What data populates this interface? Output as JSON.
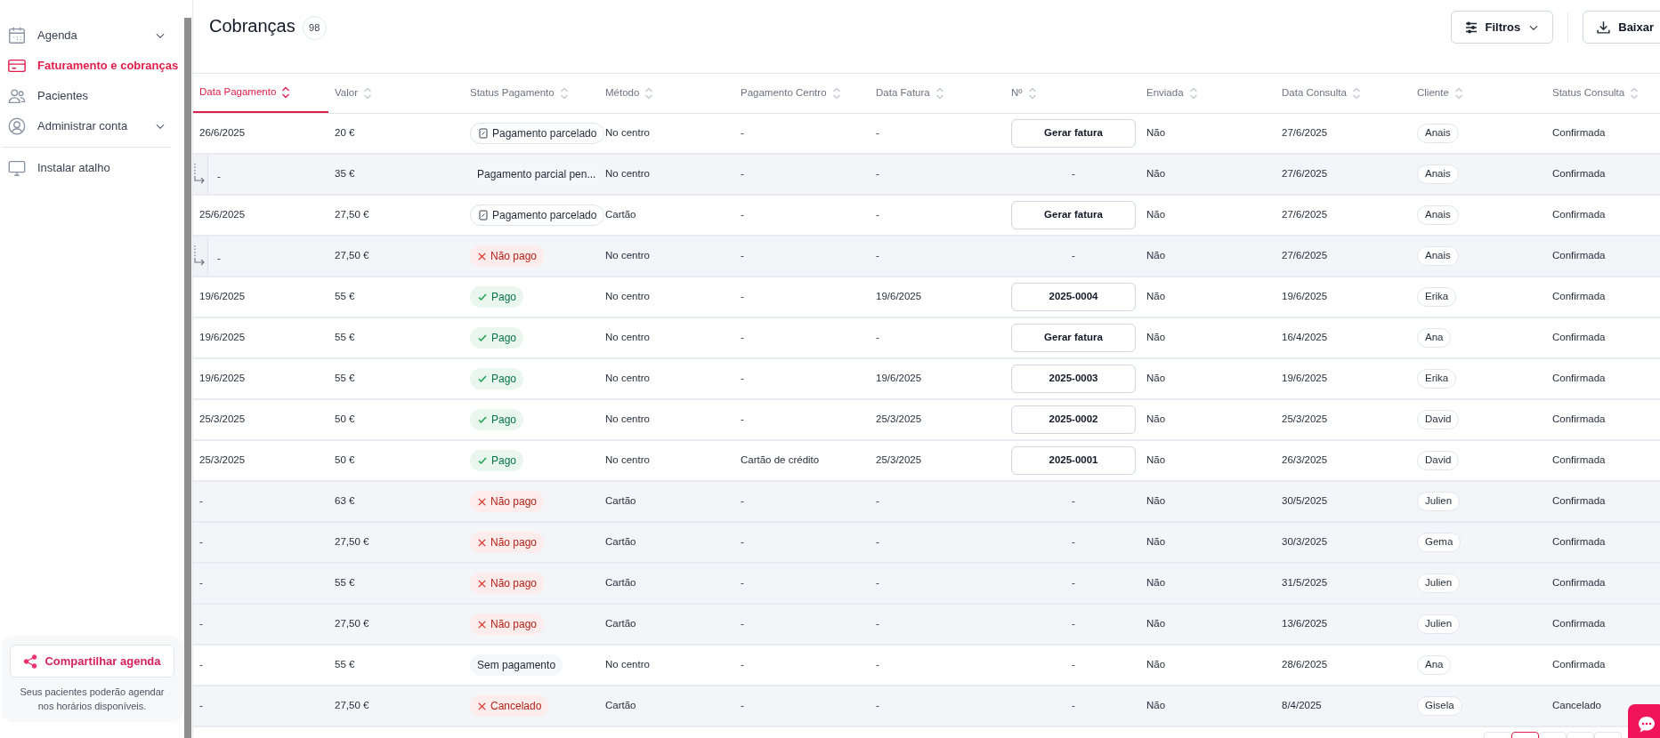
{
  "sidebar": {
    "items": [
      {
        "label": "Agenda",
        "selected": false,
        "expanded": false
      },
      {
        "label": "Faturamento e cobranças",
        "selected": true
      },
      {
        "label": "Pacientes",
        "selected": false
      },
      {
        "label": "Administrar conta",
        "selected": false,
        "expanded": false
      },
      {
        "label": "Instalar atalho",
        "selected": false
      }
    ],
    "share_card": {
      "button": "Compartilhar agenda",
      "text": "Seus pacientes poderão agendar nos horários disponíveis."
    }
  },
  "header": {
    "title": "Cobranças",
    "count": "98",
    "buttons": [
      "Filtros",
      "Baixar"
    ]
  },
  "table": {
    "columns": [
      {
        "label": "Data Pagamento",
        "selected": true
      },
      {
        "label": "Valor",
        "selected": false
      },
      {
        "label": "Status Pagamento",
        "selected": false
      },
      {
        "label": "Método",
        "selected": false
      },
      {
        "label": "Pagamento Centro",
        "selected": false
      },
      {
        "label": "Data Fatura",
        "selected": false
      },
      {
        "label": "Nº",
        "selected": false
      },
      {
        "label": "Enviada",
        "selected": false
      },
      {
        "label": "Data Consulta",
        "selected": false
      },
      {
        "label": "Cliente",
        "selected": false
      },
      {
        "label": "Status Consulta",
        "selected": false
      }
    ],
    "rows": [
      {
        "kind": "main",
        "highlighted": false,
        "date_paid": "26/6/2025",
        "amount": "20 €",
        "status": {
          "kind": "installment",
          "label": "Pagamento parcelado"
        },
        "method": "No centro",
        "center_payment": "-",
        "invoice_date": "-",
        "number": {
          "kind": "button",
          "text": "Gerar fatura"
        },
        "sent": "Não",
        "appointment_date": "27/6/2025",
        "client": "Anais",
        "appointment_status": "Confirmada"
      },
      {
        "kind": "sub",
        "highlighted": true,
        "date_paid": "-",
        "amount": "35 €",
        "status": {
          "kind": "partial",
          "label": "Pagamento parcial pen..."
        },
        "method": "No centro",
        "center_payment": "-",
        "invoice_date": "-",
        "number": {
          "kind": "text",
          "text": "-"
        },
        "sent": "Não",
        "appointment_date": "27/6/2025",
        "client": "Anais",
        "appointment_status": "Confirmada"
      },
      {
        "kind": "main",
        "highlighted": false,
        "date_paid": "25/6/2025",
        "amount": "27,50 €",
        "status": {
          "kind": "installment",
          "label": "Pagamento parcelado"
        },
        "method": "Cartão",
        "center_payment": "-",
        "invoice_date": "-",
        "number": {
          "kind": "button",
          "text": "Gerar fatura"
        },
        "sent": "Não",
        "appointment_date": "27/6/2025",
        "client": "Anais",
        "appointment_status": "Confirmada"
      },
      {
        "kind": "sub",
        "highlighted": true,
        "date_paid": "-",
        "amount": "27,50 €",
        "status": {
          "kind": "unpaid",
          "label": "Não pago"
        },
        "method": "No centro",
        "center_payment": "-",
        "invoice_date": "-",
        "number": {
          "kind": "text",
          "text": "-"
        },
        "sent": "Não",
        "appointment_date": "27/6/2025",
        "client": "Anais",
        "appointment_status": "Confirmada"
      },
      {
        "kind": "main",
        "highlighted": false,
        "date_paid": "19/6/2025",
        "amount": "55 €",
        "status": {
          "kind": "paid",
          "label": "Pago"
        },
        "method": "No centro",
        "center_payment": "-",
        "invoice_date": "19/6/2025",
        "number": {
          "kind": "button",
          "text": "2025-0004"
        },
        "sent": "Não",
        "appointment_date": "19/6/2025",
        "client": "Erika",
        "appointment_status": "Confirmada"
      },
      {
        "kind": "main",
        "highlighted": false,
        "date_paid": "19/6/2025",
        "amount": "55 €",
        "status": {
          "kind": "paid",
          "label": "Pago"
        },
        "method": "No centro",
        "center_payment": "-",
        "invoice_date": "-",
        "number": {
          "kind": "button",
          "text": "Gerar fatura"
        },
        "sent": "Não",
        "appointment_date": "16/4/2025",
        "client": "Ana",
        "appointment_status": "Confirmada"
      },
      {
        "kind": "main",
        "highlighted": false,
        "date_paid": "19/6/2025",
        "amount": "55 €",
        "status": {
          "kind": "paid",
          "label": "Pago"
        },
        "method": "No centro",
        "center_payment": "-",
        "invoice_date": "19/6/2025",
        "number": {
          "kind": "button",
          "text": "2025-0003"
        },
        "sent": "Não",
        "appointment_date": "19/6/2025",
        "client": "Erika",
        "appointment_status": "Confirmada"
      },
      {
        "kind": "main",
        "highlighted": false,
        "date_paid": "25/3/2025",
        "amount": "50 €",
        "status": {
          "kind": "paid",
          "label": "Pago"
        },
        "method": "No centro",
        "center_payment": "-",
        "invoice_date": "25/3/2025",
        "number": {
          "kind": "button",
          "text": "2025-0002"
        },
        "sent": "Não",
        "appointment_date": "25/3/2025",
        "client": "David",
        "appointment_status": "Confirmada"
      },
      {
        "kind": "main",
        "highlighted": false,
        "date_paid": "25/3/2025",
        "amount": "50 €",
        "status": {
          "kind": "paid",
          "label": "Pago"
        },
        "method": "No centro",
        "center_payment": "Cartão de crédito",
        "invoice_date": "25/3/2025",
        "number": {
          "kind": "button",
          "text": "2025-0001"
        },
        "sent": "Não",
        "appointment_date": "26/3/2025",
        "client": "David",
        "appointment_status": "Confirmada"
      },
      {
        "kind": "main",
        "highlighted": true,
        "date_paid": "-",
        "amount": "63 €",
        "status": {
          "kind": "unpaid",
          "label": "Não pago"
        },
        "method": "Cartão",
        "center_payment": "-",
        "invoice_date": "-",
        "number": {
          "kind": "text",
          "text": "-"
        },
        "sent": "Não",
        "appointment_date": "30/5/2025",
        "client": "Julien",
        "appointment_status": "Confirmada"
      },
      {
        "kind": "main",
        "highlighted": true,
        "date_paid": "-",
        "amount": "27,50 €",
        "status": {
          "kind": "unpaid",
          "label": "Não pago"
        },
        "method": "Cartão",
        "center_payment": "-",
        "invoice_date": "-",
        "number": {
          "kind": "text",
          "text": "-"
        },
        "sent": "Não",
        "appointment_date": "30/3/2025",
        "client": "Gema",
        "appointment_status": "Confirmada"
      },
      {
        "kind": "main",
        "highlighted": true,
        "date_paid": "-",
        "amount": "55 €",
        "status": {
          "kind": "unpaid",
          "label": "Não pago"
        },
        "method": "Cartão",
        "center_payment": "-",
        "invoice_date": "-",
        "number": {
          "kind": "text",
          "text": "-"
        },
        "sent": "Não",
        "appointment_date": "31/5/2025",
        "client": "Julien",
        "appointment_status": "Confirmada"
      },
      {
        "kind": "main",
        "highlighted": true,
        "date_paid": "-",
        "amount": "27,50 €",
        "status": {
          "kind": "unpaid",
          "label": "Não pago"
        },
        "method": "Cartão",
        "center_payment": "-",
        "invoice_date": "-",
        "number": {
          "kind": "text",
          "text": "-"
        },
        "sent": "Não",
        "appointment_date": "13/6/2025",
        "client": "Julien",
        "appointment_status": "Confirmada"
      },
      {
        "kind": "main",
        "highlighted": false,
        "date_paid": "-",
        "amount": "55 €",
        "status": {
          "kind": "none",
          "label": "Sem pagamento"
        },
        "method": "No centro",
        "center_payment": "-",
        "invoice_date": "-",
        "number": {
          "kind": "text",
          "text": "-"
        },
        "sent": "Não",
        "appointment_date": "28/6/2025",
        "client": "Ana",
        "appointment_status": "Confirmada"
      },
      {
        "kind": "main",
        "highlighted": true,
        "date_paid": "-",
        "amount": "27,50 €",
        "status": {
          "kind": "cancelled",
          "label": "Cancelado"
        },
        "method": "Cartão",
        "center_payment": "-",
        "invoice_date": "-",
        "number": {
          "kind": "text",
          "text": "-"
        },
        "sent": "Não",
        "appointment_date": "8/4/2025",
        "client": "Gisela",
        "appointment_status": "Cancelado"
      }
    ]
  },
  "pagination": [
    {
      "selected": false
    },
    {
      "selected": true
    },
    {
      "selected": false
    },
    {
      "selected": false
    },
    {
      "selected": false
    }
  ]
}
